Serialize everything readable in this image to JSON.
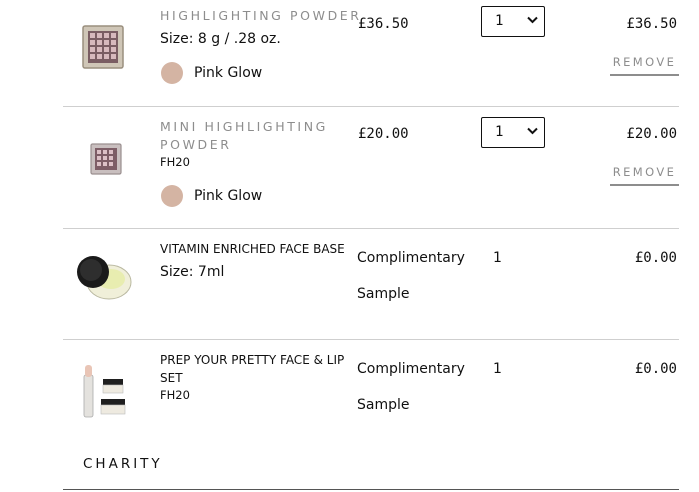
{
  "items": [
    {
      "name": "HIGHLIGHTING POWDER",
      "size": "Size: 8 g / .28 oz.",
      "shade": "Pink Glow",
      "shade_color": "#d4b4a3",
      "price": "£36.50",
      "qty": "1",
      "total": "£36.50",
      "remove": "REMOVE"
    },
    {
      "name_line1": "MINI HIGHLIGHTING",
      "name_line2": "POWDER",
      "code": "FH20",
      "shade": "Pink Glow",
      "shade_color": "#d4b4a3",
      "price": "£20.00",
      "qty": "1",
      "total": "£20.00",
      "remove": "REMOVE"
    },
    {
      "name": "VITAMIN ENRICHED FACE BASE",
      "size": "Size: 7ml",
      "price_line1": "Complimentary",
      "price_line2": "Sample",
      "qty": "1",
      "total": "£0.00"
    },
    {
      "name": "PREP YOUR PRETTY FACE & LIP SET",
      "code": "FH20",
      "price_line1": "Complimentary",
      "price_line2": "Sample",
      "qty": "1",
      "total": "£0.00"
    }
  ],
  "charity_label": "CHARITY"
}
